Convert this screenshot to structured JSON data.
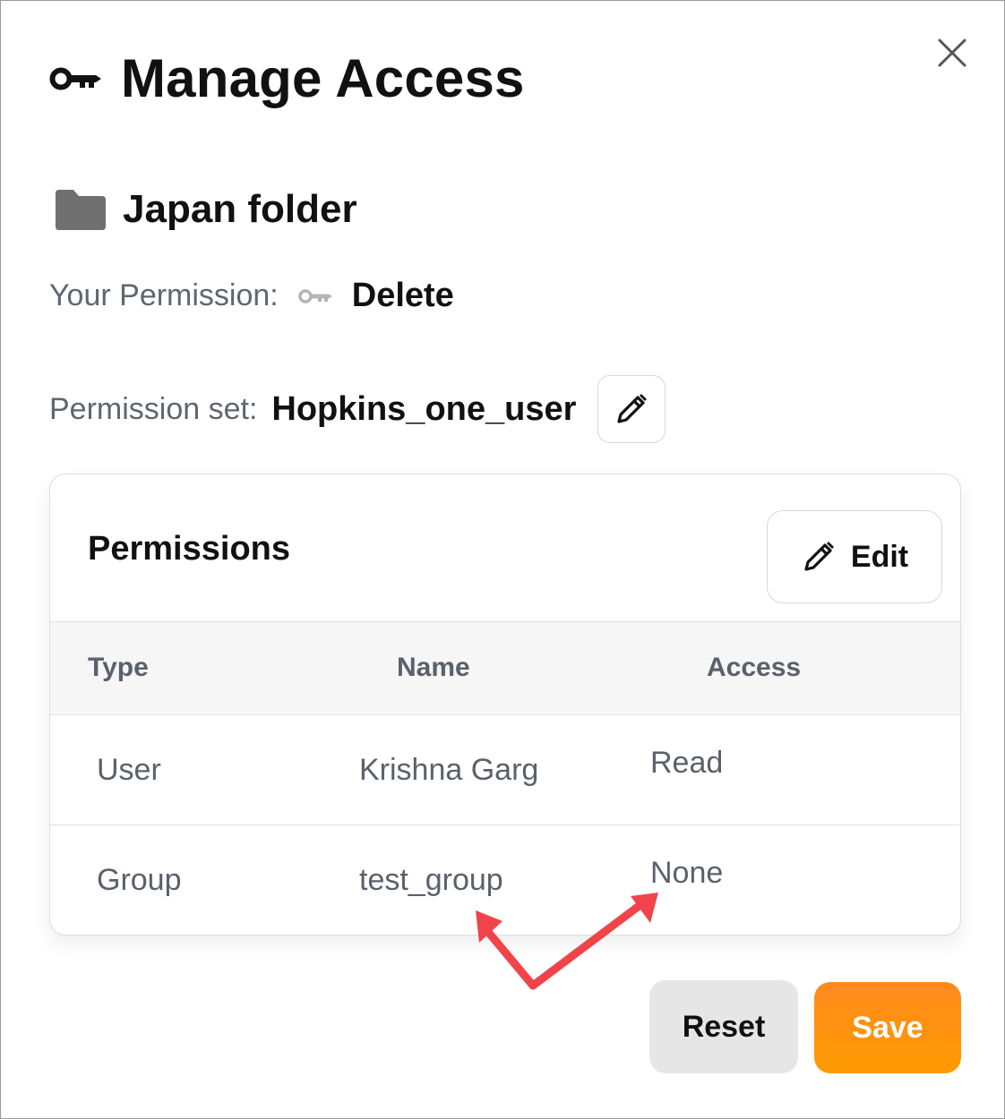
{
  "dialog": {
    "title": "Manage Access",
    "folder_name": "Japan folder",
    "your_permission_label": "Your Permission:",
    "your_permission_value": "Delete",
    "permission_set_label": "Permission set:",
    "permission_set_value": "Hopkins_one_user"
  },
  "permissions": {
    "title": "Permissions",
    "edit_label": "Edit",
    "columns": [
      "Type",
      "Name",
      "Access"
    ],
    "rows": [
      {
        "type": "User",
        "name": "Krishna Garg",
        "access": "Read"
      },
      {
        "type": "Group",
        "name": "test_group",
        "access": "None"
      }
    ]
  },
  "actions": {
    "reset_label": "Reset",
    "save_label": "Save"
  },
  "colors": {
    "accent": "#ff9200",
    "annotation_arrow": "#f0444a"
  },
  "icons": {
    "title": "key-icon",
    "folder": "folder-icon",
    "permission": "key-icon",
    "edit": "pencil-icon",
    "close": "close-icon"
  }
}
